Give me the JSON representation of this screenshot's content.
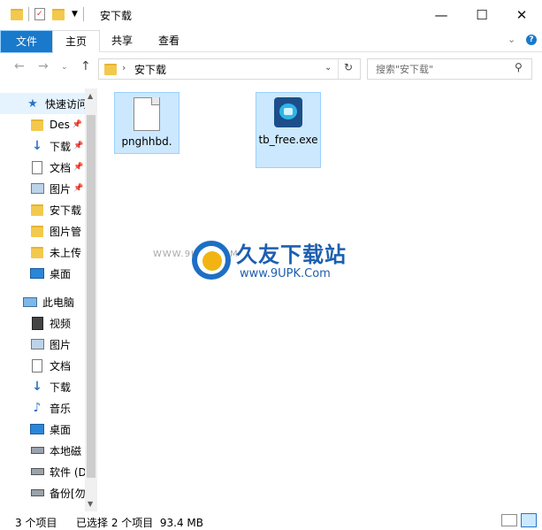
{
  "window": {
    "title": "安下载",
    "controls": [
      "—",
      "☐",
      "✕"
    ]
  },
  "ribbon": {
    "tabs": [
      "文件",
      "主页",
      "共享",
      "查看"
    ]
  },
  "address": {
    "path": "安下载",
    "search_placeholder": "搜索\"安下载\""
  },
  "nav": {
    "quick_access": "快速访问",
    "items": [
      "Des",
      "下载",
      "文档",
      "图片",
      "安下载",
      "图片管",
      "未上传",
      "桌面"
    ],
    "this_pc": "此电脑",
    "pc_items": [
      "视频",
      "图片",
      "文档",
      "下载",
      "音乐",
      "桌面",
      "本地磁",
      "软件 (D",
      "备份[勿"
    ]
  },
  "files": [
    {
      "name": "pnghhbd.",
      "icon": "blank-file-icon"
    },
    {
      "name": "tb_free.exe",
      "icon": "setup-exe-icon"
    }
  ],
  "watermark": {
    "line1": "久友下载站",
    "line2": "www.9UPK.Com",
    "prefix": "WWW.9UPK.COM"
  },
  "status": {
    "count": "3 个项目",
    "selected": "已选择 2 个项目  93.4 MB"
  },
  "colors": {
    "accent": "#1979ca",
    "selection": "#cce8ff",
    "folder": "#f3c94d"
  }
}
